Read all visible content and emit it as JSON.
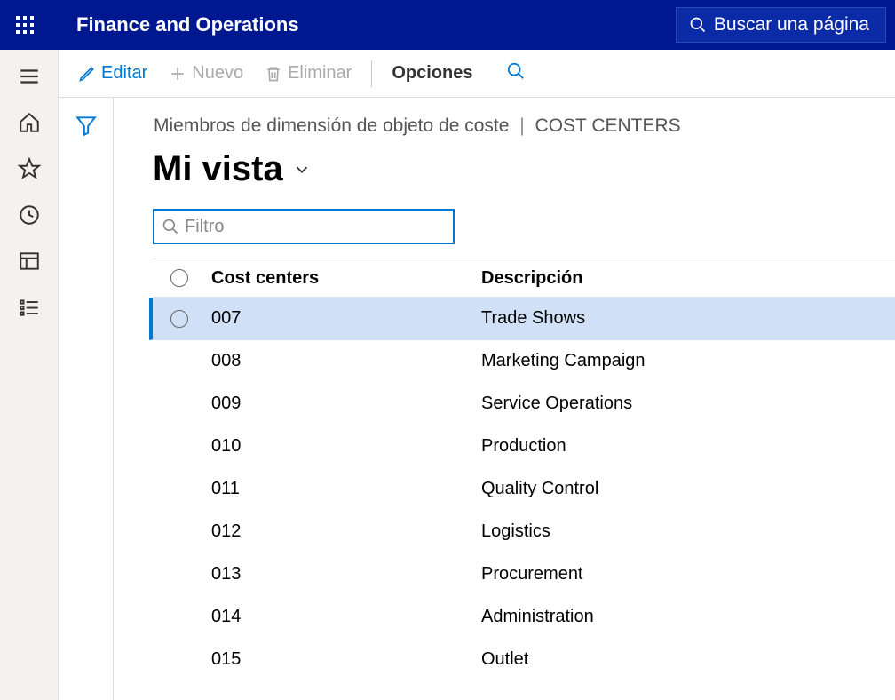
{
  "header": {
    "app_title": "Finance and Operations",
    "search_label": "Buscar una página"
  },
  "actionbar": {
    "edit": "Editar",
    "new": "Nuevo",
    "delete": "Eliminar",
    "options": "Opciones"
  },
  "breadcrumb": {
    "part1": "Miembros de dimensión de objeto de coste",
    "part2": "COST CENTERS"
  },
  "view": {
    "title": "Mi vista"
  },
  "filter": {
    "placeholder": "Filtro"
  },
  "grid": {
    "columns": {
      "code": "Cost centers",
      "desc": "Descripción"
    },
    "rows": [
      {
        "code": "007",
        "desc": "Trade Shows",
        "selected": true
      },
      {
        "code": "008",
        "desc": "Marketing Campaign",
        "selected": false
      },
      {
        "code": "009",
        "desc": "Service Operations",
        "selected": false
      },
      {
        "code": "010",
        "desc": "Production",
        "selected": false
      },
      {
        "code": "011",
        "desc": "Quality Control",
        "selected": false
      },
      {
        "code": "012",
        "desc": "Logistics",
        "selected": false
      },
      {
        "code": "013",
        "desc": "Procurement",
        "selected": false
      },
      {
        "code": "014",
        "desc": "Administration",
        "selected": false
      },
      {
        "code": "015",
        "desc": "Outlet",
        "selected": false
      }
    ]
  }
}
